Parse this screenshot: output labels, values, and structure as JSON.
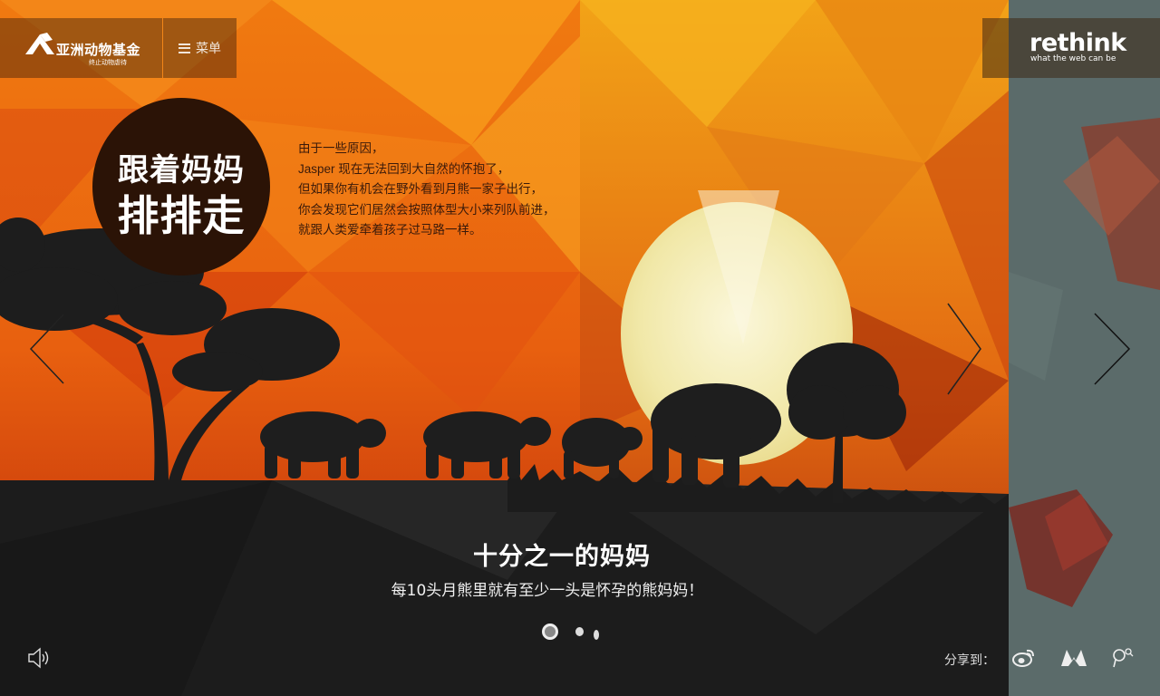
{
  "header": {
    "logo_title": "亚洲动物基金",
    "logo_subtitle": "终止动物虐待",
    "menu_label": "菜单",
    "rethink_logo": "rethink",
    "rethink_tagline": "what the web can be"
  },
  "story": {
    "title_line1": "跟着妈妈",
    "title_line2": "排排走",
    "lines": [
      "由于一些原因，",
      "Jasper 现在无法回到大自然的怀抱了，",
      "但如果你有机会在野外看到月熊一家子出行，",
      "你会发现它们居然会按照体型大小来列队前进，",
      "就跟人类爱牵着孩子过马路一样。"
    ]
  },
  "caption": {
    "title": "十分之一的妈妈",
    "subtitle": "每10头月熊里就有至少一头是怀孕的熊妈妈！"
  },
  "pagination": {
    "total": 3,
    "active": 1
  },
  "share": {
    "label": "分享到：",
    "targets": [
      "weibo-icon",
      "renren-icon",
      "qq-icon"
    ]
  },
  "colors": {
    "sky_top": "#f7a21b",
    "sky_mid": "#e85a10",
    "sky_low": "#b8260a",
    "moon": "#f2ecb4",
    "ground": "#1a1a1a",
    "circle": "#2b1306",
    "side_panel": "#5a6a68"
  }
}
